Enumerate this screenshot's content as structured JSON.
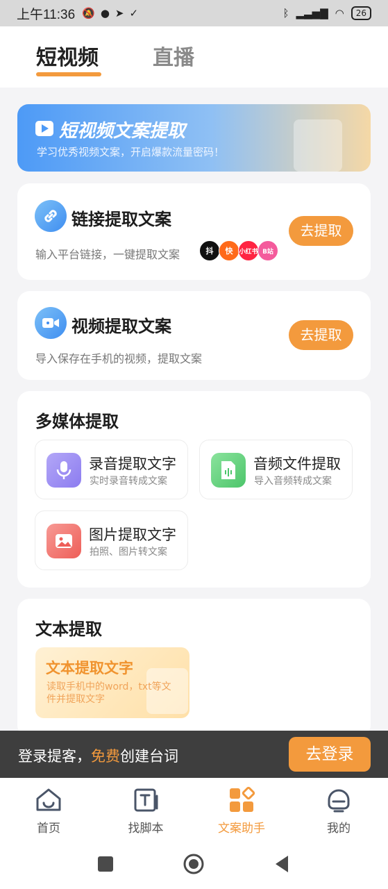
{
  "status": {
    "time": "上午11:36",
    "battery": "26"
  },
  "tabs": [
    {
      "label": "短视频"
    },
    {
      "label": "直播"
    }
  ],
  "banner": {
    "title": "短视频文案提取",
    "subtitle": "学习优秀视频文案，开启爆款流量密码！"
  },
  "link_card": {
    "title": "链接提取文案",
    "desc": "输入平台链接，一键提取文案",
    "button": "去提取",
    "platforms": [
      "抖",
      "快",
      "小红书",
      "B站"
    ]
  },
  "video_card": {
    "title": "视频提取文案",
    "desc": "导入保存在手机的视频，提取文案",
    "button": "去提取"
  },
  "multimedia": {
    "title": "多媒体提取",
    "tools": [
      {
        "name": "录音提取文字",
        "desc": "实时录音转成文案",
        "icon": "microphone-icon",
        "color": "#9b8cf2"
      },
      {
        "name": "音频文件提取",
        "desc": "导入音频转成文案",
        "icon": "audio-file-icon",
        "color": "#5fd07a"
      },
      {
        "name": "图片提取文字",
        "desc": "拍照、图片转文案",
        "icon": "image-icon",
        "color": "#f2706b"
      }
    ]
  },
  "text_extract": {
    "title": "文本提取",
    "tile_title": "文本提取文字",
    "tile_desc": "读取手机中的word，txt等文件并提取文字"
  },
  "login_bar": {
    "text_before": "登录提客，",
    "highlight": "免费",
    "text_after": "创建台词",
    "button": "去登录"
  },
  "bottom_nav": [
    {
      "label": "首页",
      "icon": "home-icon"
    },
    {
      "label": "找脚本",
      "icon": "script-icon"
    },
    {
      "label": "文案助手",
      "icon": "assistant-icon",
      "active": true
    },
    {
      "label": "我的",
      "icon": "profile-icon"
    }
  ],
  "colors": {
    "accent": "#f39a3d",
    "blue": "#3f8ef1"
  }
}
